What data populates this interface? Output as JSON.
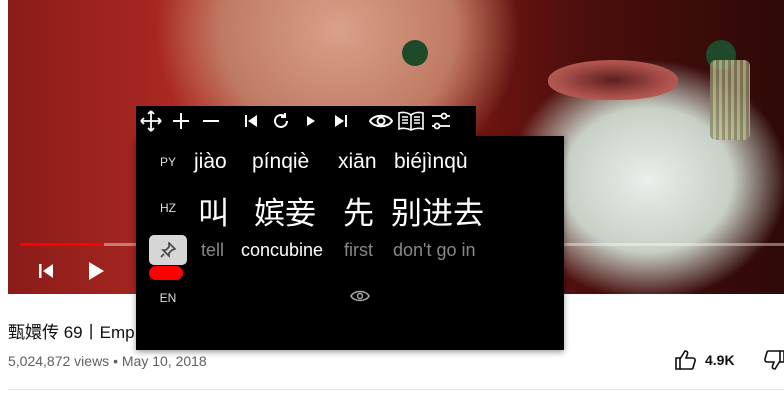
{
  "video": {
    "title": "甄嬛传 69丨Emp",
    "views": "5,024,872 views",
    "date": "May 10, 2018",
    "likes": "4.9K",
    "progress": 0.11
  },
  "toolbar": {
    "icons": [
      "move-icon",
      "plus-icon",
      "minus-icon",
      "skip-back-icon",
      "replay-icon",
      "play-small-icon",
      "skip-forward-icon",
      "eye-icon",
      "dictionary-icon",
      "settings-sliders-icon"
    ]
  },
  "subtitles": {
    "labels": {
      "py": "PY",
      "hz": "HZ",
      "en": "EN"
    },
    "pinyin": [
      "jiào",
      "pínqiè",
      "xiān",
      "biéjìnqù"
    ],
    "hanzi": [
      "叫",
      "嫔妾",
      "先",
      "别进去"
    ],
    "english": [
      "tell",
      "concubine",
      "first",
      "don't go in"
    ],
    "active_index": 1
  },
  "colors": {
    "accent": "#ff0000",
    "panel": "#000000"
  }
}
